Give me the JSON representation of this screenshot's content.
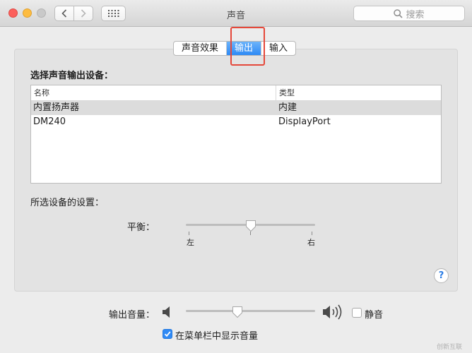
{
  "window": {
    "title": "声音",
    "search_placeholder": "搜索"
  },
  "tabs": [
    {
      "label": "声音效果",
      "active": false
    },
    {
      "label": "输出",
      "active": true
    },
    {
      "label": "输入",
      "active": false
    }
  ],
  "output": {
    "select_device_label": "选择声音输出设备：",
    "table": {
      "columns": [
        "名称",
        "类型"
      ],
      "rows": [
        {
          "name": "内置扬声器",
          "type": "内建",
          "selected": true
        },
        {
          "name": "DM240",
          "type": "DisplayPort",
          "selected": false
        }
      ]
    },
    "settings_label": "所选设备的设置：",
    "balance": {
      "label": "平衡：",
      "left_label": "左",
      "right_label": "右",
      "value": 0.5
    }
  },
  "bottom": {
    "volume_label": "输出音量：",
    "volume_value": 0.4,
    "mute_label": "静音",
    "mute_checked": false,
    "show_in_menubar_label": "在菜单栏中显示音量",
    "show_in_menubar_checked": true
  },
  "watermark": "创新互联",
  "colors": {
    "accent": "#2f8af5",
    "highlight_box": "#e5483a"
  },
  "icons": [
    "chevron-left-icon",
    "chevron-right-icon",
    "grid-icon",
    "search-icon",
    "speaker-low-icon",
    "speaker-high-icon",
    "help-icon",
    "checkmark-icon"
  ]
}
